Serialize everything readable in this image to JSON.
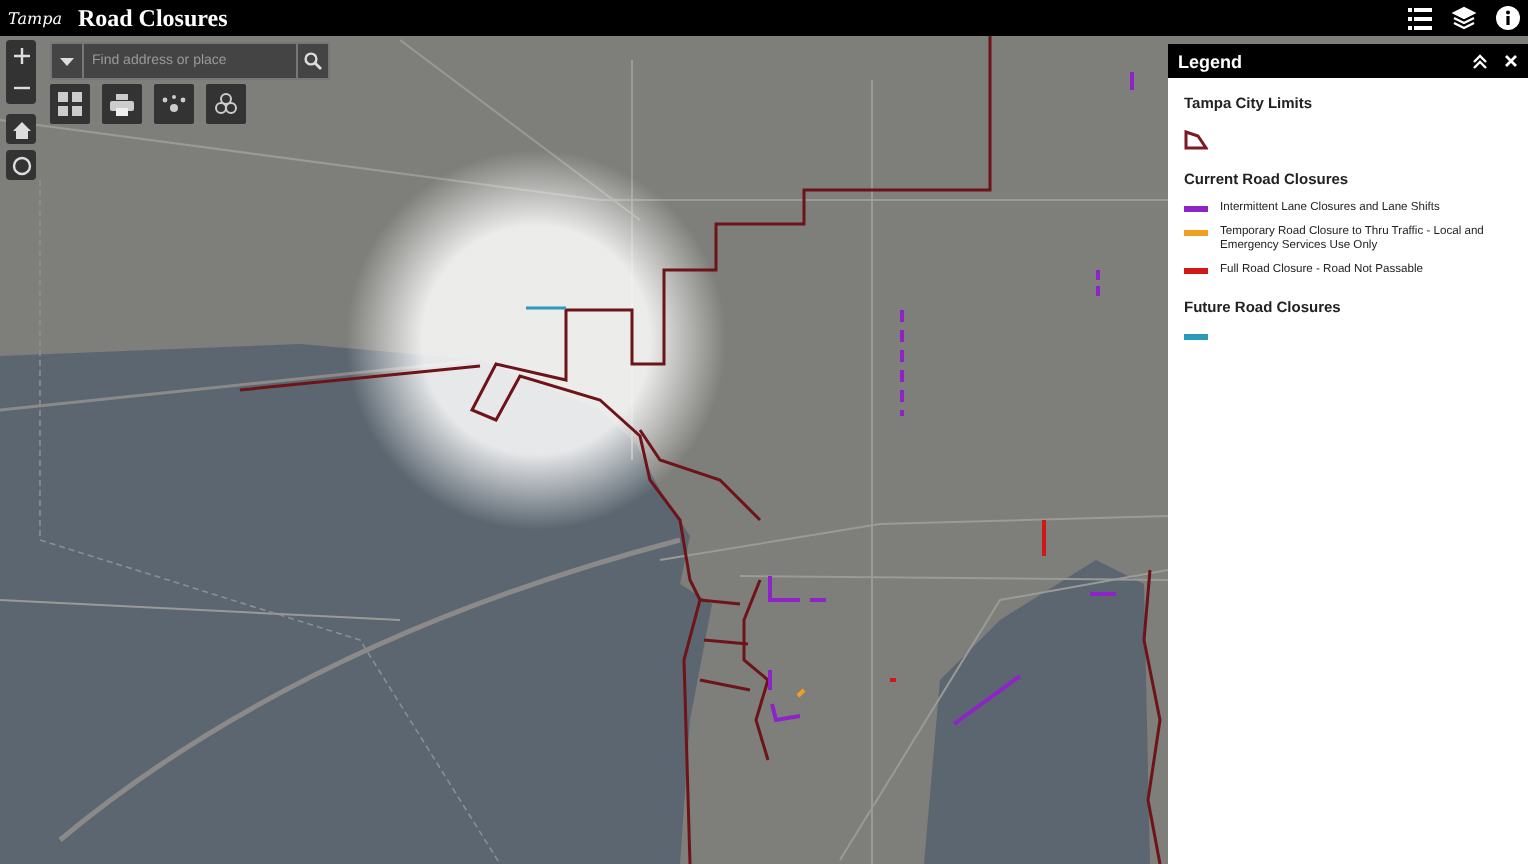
{
  "header": {
    "logo": "Tampa",
    "title": "Road Closures"
  },
  "search": {
    "placeholder": "Find address or place"
  },
  "legend": {
    "title": "Legend",
    "sections": [
      {
        "heading": "Tampa City Limits",
        "items": [
          {
            "kind": "polygon",
            "color": "#7a1a22"
          }
        ]
      },
      {
        "heading": "Current Road Closures",
        "items": [
          {
            "kind": "line",
            "color": "#8e24c8",
            "label": "Intermittent Lane Closures and Lane Shifts"
          },
          {
            "kind": "line",
            "color": "#f0a020",
            "label": "Temporary Road Closure to Thru Traffic - Local and Emergency Services Use Only"
          },
          {
            "kind": "line",
            "color": "#d01818",
            "label": "Full Road Closure - Road Not Passable"
          }
        ]
      },
      {
        "heading": "Future Road Closures",
        "items": [
          {
            "kind": "line",
            "color": "#2a9ab8"
          }
        ]
      }
    ]
  }
}
